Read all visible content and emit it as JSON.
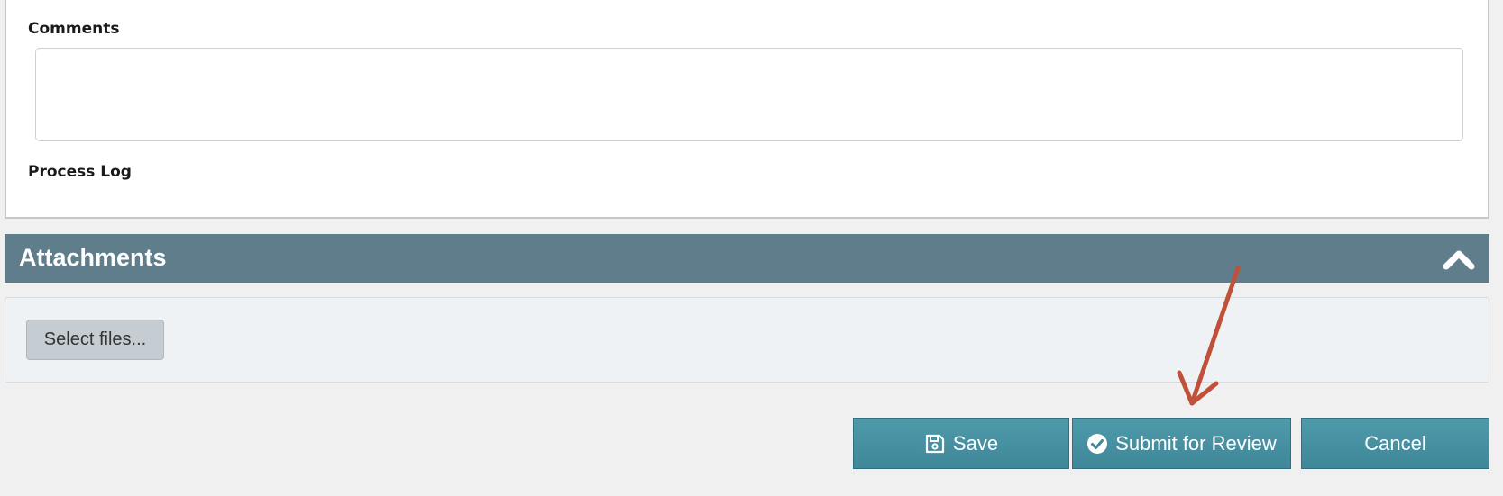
{
  "form": {
    "comments_label": "Comments",
    "comments_value": "",
    "process_log_label": "Process Log"
  },
  "attachments": {
    "title": "Attachments",
    "collapse_icon": "chevron-up-icon",
    "select_files_label": "Select files..."
  },
  "actions": {
    "save_label": "Save",
    "save_icon": "floppy-disk-icon",
    "submit_label": "Submit for Review",
    "submit_icon": "check-circle-icon",
    "cancel_label": "Cancel"
  },
  "colors": {
    "header_bg": "#607d8b",
    "button_bg": "#4a93a4",
    "annotation_arrow": "#c0503a"
  }
}
